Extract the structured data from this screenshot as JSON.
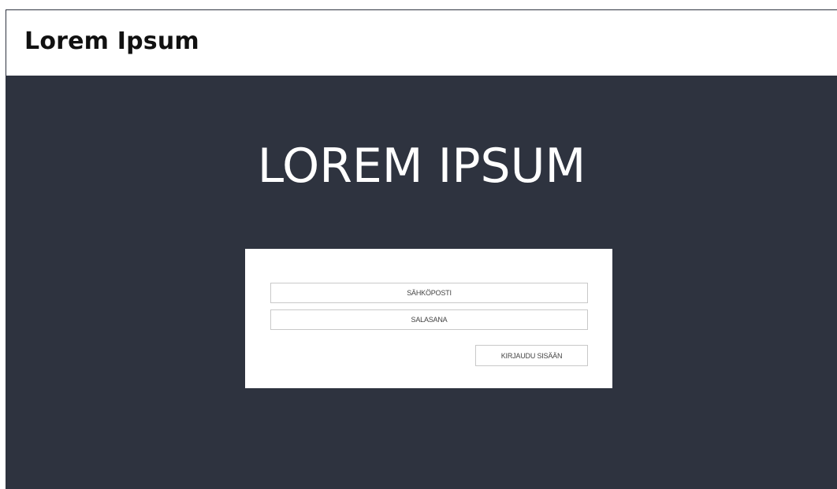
{
  "app": {
    "title": "Lorem Ipsum"
  },
  "hero": {
    "title": "LOREM IPSUM"
  },
  "login": {
    "email_placeholder": "SÄHKÖPOSTI",
    "password_placeholder": "SALASANA",
    "submit_label": "KIRJAUDU SISÄÄN"
  },
  "colors": {
    "panel_background": "#2e333f",
    "card_background": "#ffffff",
    "field_border": "#c9c9c9"
  }
}
